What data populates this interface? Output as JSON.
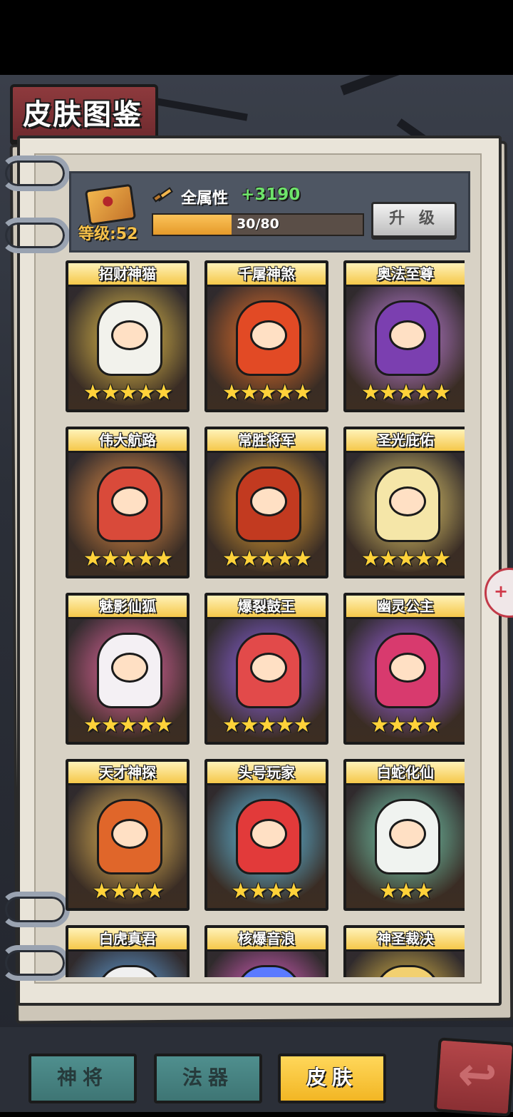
{
  "header": {
    "title": "皮肤图鉴"
  },
  "summary": {
    "level_label": "等级:52",
    "attribute_label": "全属性",
    "attribute_value": "+3190",
    "progress_text": "30/80",
    "progress_fraction": 0.375,
    "upgrade_label": "升 级"
  },
  "skins": [
    {
      "name": "招财神猫",
      "stars": "★★★★★",
      "glow": "#ffd54f",
      "hero": "#f2f2ec"
    },
    {
      "name": "千屠神煞",
      "stars": "★★★★★",
      "glow": "#ff7a2a",
      "hero": "#e24a25"
    },
    {
      "name": "奥法至尊",
      "stars": "★★★★★",
      "glow": "#d58cf2",
      "hero": "#7b3fb0"
    },
    {
      "name": "伟大航路",
      "stars": "★★★★★",
      "glow": "#ff9d4a",
      "hero": "#d94a3a"
    },
    {
      "name": "常胜将军",
      "stars": "★★★★★",
      "glow": "#ffb233",
      "hero": "#c23a20"
    },
    {
      "name": "圣光庇佑",
      "stars": "★★★★★",
      "glow": "#ffe275",
      "hero": "#f5e6a8"
    },
    {
      "name": "魅影仙狐",
      "stars": "★★★★★",
      "glow": "#ff6fb0",
      "hero": "#f4f0f4"
    },
    {
      "name": "爆裂鼓王",
      "stars": "★★★★★",
      "glow": "#9b6cff",
      "hero": "#e24a4a"
    },
    {
      "name": "幽灵公主",
      "stars": "★★★★",
      "glow": "#b06cff",
      "hero": "#d83a6e"
    },
    {
      "name": "天才神探",
      "stars": "★★★★",
      "glow": "#ffca5a",
      "hero": "#e0662a"
    },
    {
      "name": "头号玩家",
      "stars": "★★★★",
      "glow": "#6ad6ff",
      "hero": "#e23a3a"
    },
    {
      "name": "白蛇化仙",
      "stars": "★★★",
      "glow": "#7fe3c0",
      "hero": "#f0f3f0"
    },
    {
      "name": "白虎真君",
      "stars": "",
      "glow": "#6ab8ff",
      "hero": "#f0f0f0"
    },
    {
      "name": "核爆音浪",
      "stars": "",
      "glow": "#ff6adf",
      "hero": "#5a7aff"
    },
    {
      "name": "神圣裁决",
      "stars": "",
      "glow": "#ffd54f",
      "hero": "#f2d070"
    }
  ],
  "side_button": {
    "glyph": "+"
  },
  "tabs": [
    {
      "label": "神将"
    },
    {
      "label": "法器"
    },
    {
      "label": "皮肤"
    }
  ],
  "back_button": {
    "glyph": "↩"
  }
}
